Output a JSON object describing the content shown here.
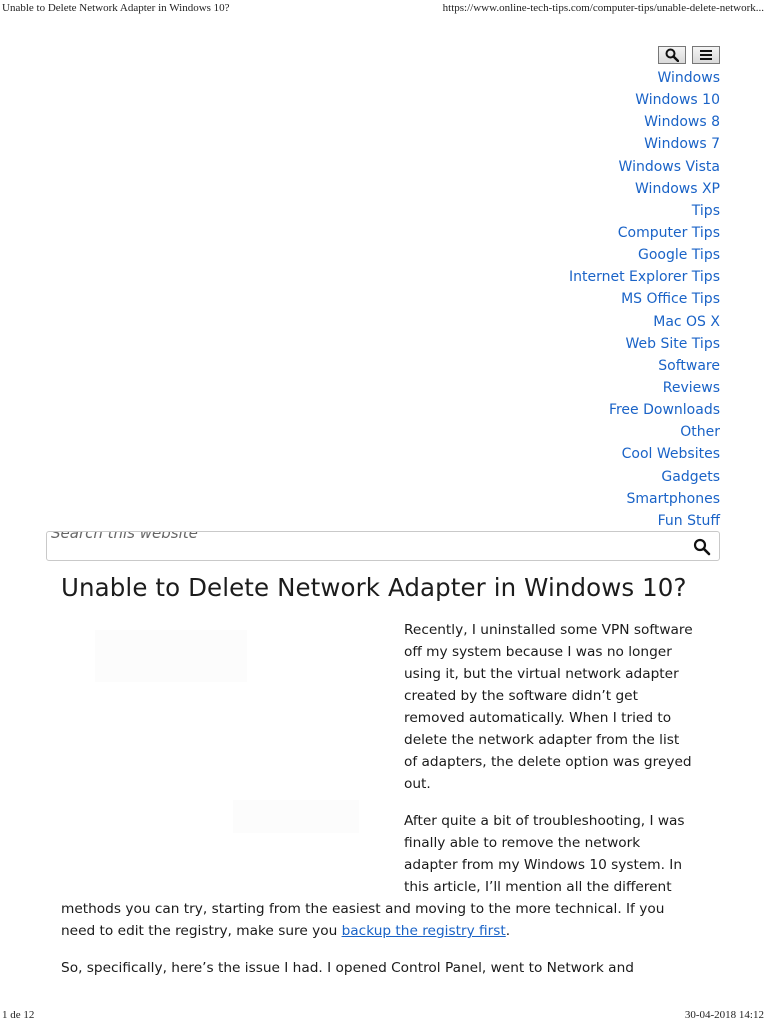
{
  "print_header": {
    "title": "Unable to Delete Network Adapter in Windows 10?",
    "url": "https://www.online-tech-tips.com/computer-tips/unable-delete-network..."
  },
  "print_footer": {
    "page": "1 de 12",
    "timestamp": "30-04-2018 14:12"
  },
  "icons": {
    "search": "search-icon",
    "menu": "menu-icon"
  },
  "nav": [
    "Windows",
    "Windows 10",
    "Windows 8",
    "Windows 7",
    "Windows Vista",
    "Windows XP",
    "Tips",
    "Computer Tips",
    "Google Tips",
    "Internet Explorer Tips",
    "MS Office Tips",
    "Mac OS X",
    "Web Site Tips",
    "Software",
    "Reviews",
    "Free Downloads",
    "Other",
    "Cool Websites",
    "Gadgets",
    "Smartphones",
    "Fun Stuff"
  ],
  "search": {
    "placeholder": "Search this website"
  },
  "article": {
    "title": "Unable to Delete Network Adapter in Windows 10?",
    "p1_lines": [
      "Recently, I uninstalled some VPN software",
      "off my system because I was no longer",
      "using it, but the virtual network adapter",
      "created by the software didn’t get",
      "removed automatically. When I tried to",
      "delete the network adapter from the list",
      "of adapters, the delete option was greyed",
      "out."
    ],
    "p2_lines_narrow": [
      "After quite a bit of troubleshooting, I was",
      "finally able to remove the network",
      "adapter from my Windows 10 system. In",
      "this article, I’ll mention all the different"
    ],
    "p2_line_wide": "methods you can try, starting from the easiest and moving to the more technical. If you",
    "p2_last_prefix": "need to edit the registry, make sure you ",
    "p2_link": "backup the registry first",
    "p2_last_suffix": ".",
    "p3_line": "So, specifically, here’s the issue I had. I opened Control Panel, went to Network and"
  },
  "colors": {
    "link": "#1a63c7",
    "text": "#1a1a1a"
  }
}
